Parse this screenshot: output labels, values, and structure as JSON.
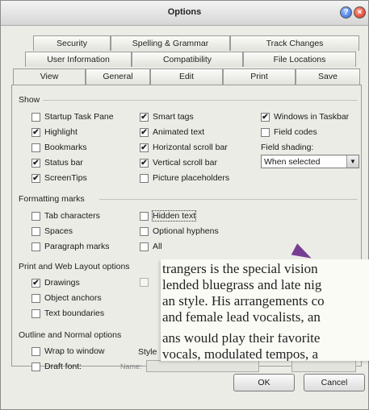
{
  "window": {
    "title": "Options"
  },
  "tabs": {
    "row1": [
      "Security",
      "Spelling & Grammar",
      "Track Changes"
    ],
    "row2": [
      "User Information",
      "Compatibility",
      "File Locations"
    ],
    "row3": [
      "View",
      "General",
      "Edit",
      "Print",
      "Save"
    ]
  },
  "show": {
    "heading": "Show",
    "col1": [
      {
        "label": "Startup Task Pane",
        "checked": false
      },
      {
        "label": "Highlight",
        "checked": true
      },
      {
        "label": "Bookmarks",
        "checked": false
      },
      {
        "label": "Status bar",
        "checked": true
      },
      {
        "label": "ScreenTips",
        "checked": true
      }
    ],
    "col2": [
      {
        "label": "Smart tags",
        "checked": true
      },
      {
        "label": "Animated text",
        "checked": true
      },
      {
        "label": "Horizontal scroll bar",
        "checked": true
      },
      {
        "label": "Vertical scroll bar",
        "checked": true
      },
      {
        "label": "Picture placeholders",
        "checked": false
      }
    ],
    "col3": [
      {
        "label": "Windows in Taskbar",
        "checked": true
      },
      {
        "label": "Field codes",
        "checked": false
      }
    ],
    "field_shading_label": "Field shading:",
    "field_shading_value": "When selected"
  },
  "formatting": {
    "heading": "Formatting marks",
    "col1": [
      {
        "label": "Tab characters",
        "checked": false
      },
      {
        "label": "Spaces",
        "checked": false
      },
      {
        "label": "Paragraph marks",
        "checked": false
      }
    ],
    "col2": [
      {
        "label": "Hidden text",
        "checked": false
      },
      {
        "label": "Optional hyphens",
        "checked": false
      },
      {
        "label": "All",
        "checked": false
      }
    ]
  },
  "print_layout": {
    "heading": "Print and Web Layout options",
    "col1": [
      {
        "label": "Drawings",
        "checked": true
      },
      {
        "label": "Object anchors",
        "checked": false
      },
      {
        "label": "Text boundaries",
        "checked": false
      }
    ]
  },
  "outline": {
    "heading": "Outline and Normal options",
    "col1": [
      {
        "label": "Wrap to window",
        "checked": false
      },
      {
        "label": "Draft font:",
        "checked": false
      }
    ],
    "style_label": "Style",
    "name_label": "Name:"
  },
  "overlay_text": [
    "trangers is the special vision",
    "lended bluegrass and late nig",
    "an style. His arrangements co",
    "and female lead vocalists, an",
    "ans would play their favorite",
    "vocals, modulated tempos, a"
  ],
  "buttons": {
    "ok": "OK",
    "cancel": "Cancel"
  },
  "check_mark": "✔"
}
